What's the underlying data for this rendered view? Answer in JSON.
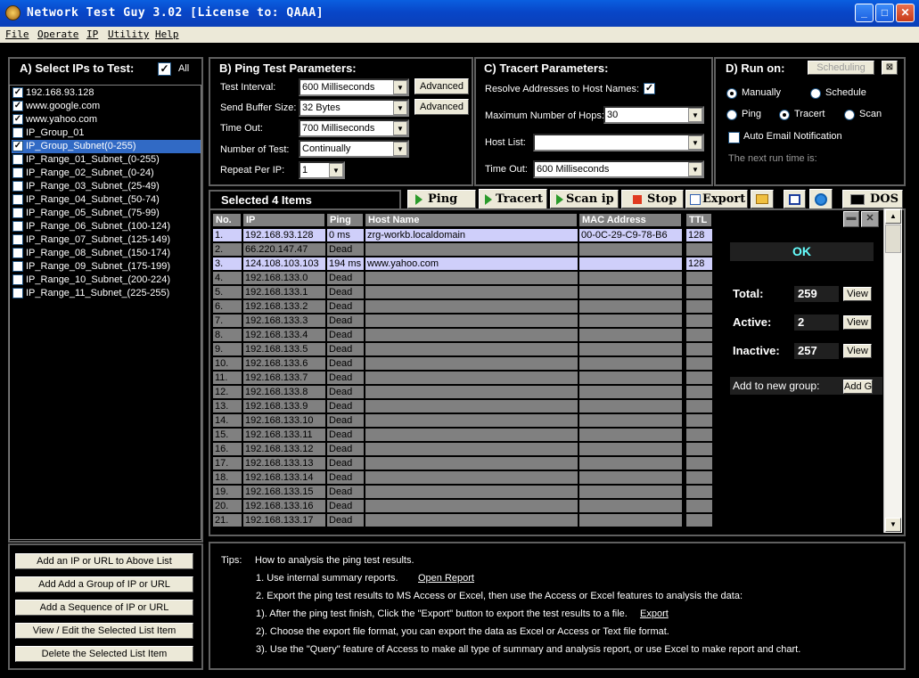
{
  "window": {
    "title": "Network Test Guy  3.02   [License to: QAAA]"
  },
  "menu": [
    "File",
    "Operate",
    "IP",
    "Utility",
    "Help"
  ],
  "panelA": {
    "title": "A) Select IPs to Test:",
    "all_label": "All",
    "items": [
      {
        "label": "192.168.93.128",
        "checked": true
      },
      {
        "label": "www.google.com",
        "checked": true
      },
      {
        "label": "www.yahoo.com",
        "checked": true
      },
      {
        "label": "IP_Group_01",
        "checked": false
      },
      {
        "label": "IP_Group_Subnet(0-255)",
        "checked": true,
        "selected": true
      },
      {
        "label": "IP_Range_01_Subnet_(0-255)",
        "checked": false
      },
      {
        "label": "IP_Range_02_Subnet_(0-24)",
        "checked": false
      },
      {
        "label": "IP_Range_03_Subnet_(25-49)",
        "checked": false
      },
      {
        "label": "IP_Range_04_Subnet_(50-74)",
        "checked": false
      },
      {
        "label": "IP_Range_05_Subnet_(75-99)",
        "checked": false
      },
      {
        "label": "IP_Range_06_Subnet_(100-124)",
        "checked": false
      },
      {
        "label": "IP_Range_07_Subnet_(125-149)",
        "checked": false
      },
      {
        "label": "IP_Range_08_Subnet_(150-174)",
        "checked": false
      },
      {
        "label": "IP_Range_09_Subnet_(175-199)",
        "checked": false
      },
      {
        "label": "IP_Range_10_Subnet_(200-224)",
        "checked": false
      },
      {
        "label": "IP_Range_11_Subnet_(225-255)",
        "checked": false
      }
    ],
    "buttons": [
      "Add an IP or URL to Above List",
      "Add Add a Group of IP or URL",
      "Add a Sequence of IP or URL",
      "View / Edit the Selected List Item",
      "Delete the Selected List Item"
    ]
  },
  "panelB": {
    "title": "B) Ping Test Parameters:",
    "interval_label": "Test Interval:",
    "interval_value": "600  Milliseconds",
    "buffer_label": "Send Buffer Size:",
    "buffer_value": "32  Bytes",
    "timeout_label": "Time Out:",
    "timeout_value": "700  Milliseconds",
    "number_label": "Number of Test:",
    "number_value": "Continually",
    "repeat_label": "Repeat Per IP:",
    "repeat_value": "1",
    "advanced": "Advanced"
  },
  "panelC": {
    "title": "C) Tracert Parameters:",
    "resolve_label": "Resolve Addresses to Host Names:",
    "hops_label": "Maximum Number of Hops:",
    "hops_value": "30",
    "hostlist_label": "Host List:",
    "hostlist_value": "",
    "timeout_label": "Time Out:",
    "timeout_value": "600  Milliseconds"
  },
  "panelD": {
    "title": "D) Run on:",
    "scheduling": "Scheduling",
    "manually": "Manually",
    "schedule": "Schedule",
    "ping": "Ping",
    "tracert": "Tracert",
    "scan": "Scan",
    "email": "Auto Email Notification",
    "nextrun": "The next run time is:"
  },
  "toolbar": {
    "selected": "Selected 4 Items",
    "ping": "Ping",
    "tracert": "Tracert",
    "scan": "Scan ip",
    "stop": "Stop",
    "export": "Export",
    "dos": "DOS"
  },
  "table": {
    "headers": [
      "No.",
      "IP",
      "Ping",
      "Host Name",
      "MAC Address",
      "TTL"
    ],
    "rows": [
      [
        "1.",
        "192.168.93.128",
        "0 ms",
        "zrg-workb.localdomain",
        "00-0C-29-C9-78-B6",
        "128"
      ],
      [
        "2.",
        "66.220.147.47",
        "Dead",
        "",
        "",
        ""
      ],
      [
        "3.",
        "124.108.103.103",
        "194 ms",
        "www.yahoo.com",
        "",
        "128"
      ],
      [
        "4.",
        "192.168.133.0",
        "Dead",
        "",
        "",
        ""
      ],
      [
        "5.",
        "192.168.133.1",
        "Dead",
        "",
        "",
        ""
      ],
      [
        "6.",
        "192.168.133.2",
        "Dead",
        "",
        "",
        ""
      ],
      [
        "7.",
        "192.168.133.3",
        "Dead",
        "",
        "",
        ""
      ],
      [
        "8.",
        "192.168.133.4",
        "Dead",
        "",
        "",
        ""
      ],
      [
        "9.",
        "192.168.133.5",
        "Dead",
        "",
        "",
        ""
      ],
      [
        "10.",
        "192.168.133.6",
        "Dead",
        "",
        "",
        ""
      ],
      [
        "11.",
        "192.168.133.7",
        "Dead",
        "",
        "",
        ""
      ],
      [
        "12.",
        "192.168.133.8",
        "Dead",
        "",
        "",
        ""
      ],
      [
        "13.",
        "192.168.133.9",
        "Dead",
        "",
        "",
        ""
      ],
      [
        "14.",
        "192.168.133.10",
        "Dead",
        "",
        "",
        ""
      ],
      [
        "15.",
        "192.168.133.11",
        "Dead",
        "",
        "",
        ""
      ],
      [
        "16.",
        "192.168.133.12",
        "Dead",
        "",
        "",
        ""
      ],
      [
        "17.",
        "192.168.133.13",
        "Dead",
        "",
        "",
        ""
      ],
      [
        "18.",
        "192.168.133.14",
        "Dead",
        "",
        "",
        ""
      ],
      [
        "19.",
        "192.168.133.15",
        "Dead",
        "",
        "",
        ""
      ],
      [
        "20.",
        "192.168.133.16",
        "Dead",
        "",
        "",
        ""
      ],
      [
        "21.",
        "192.168.133.17",
        "Dead",
        "",
        "",
        ""
      ]
    ]
  },
  "summary": {
    "status": "OK",
    "total_label": "Total:",
    "total": "259",
    "active_label": "Active:",
    "active": "2",
    "inactive_label": "Inactive:",
    "inactive": "257",
    "view": "View",
    "addgroup_label": "Add to new group:",
    "addgroup_btn": "Add G"
  },
  "tips": {
    "head": "Tips:",
    "intro": "How to analysis the ping test results.",
    "l1": "1.   Use internal summary reports.",
    "l1link": "Open Report",
    "l2": "2.   Export the ping test results to MS Access or Excel, then use the Access or Excel features to analysis the data:",
    "l3": "1).  After the ping test finish, Click the \"Export\" button to export the test results to a file.",
    "l3link": "Export",
    "l4": "2).  Choose the export file format, you can export the data as Excel or Access or Text file format.",
    "l5": "3).  Use the \"Query\" feature of Access to make all type of summary and analysis report, or use Excel to make report and chart."
  }
}
